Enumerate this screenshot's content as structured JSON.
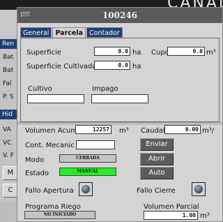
{
  "background": {
    "top_text": "CANAL",
    "side_headers": [
      "Ren",
      "Hid"
    ],
    "side_items_1": [
      "Bat",
      "Bat",
      "Fal",
      "P. S"
    ],
    "side_items_2": [
      "VA",
      "VC",
      "V. F"
    ],
    "side_buttons": [
      "M",
      "C"
    ]
  },
  "dialog": {
    "title": "100246",
    "tabs": [
      {
        "label": "General",
        "active": false
      },
      {
        "label": "Parcela",
        "active": true
      },
      {
        "label": "Contador",
        "active": false
      }
    ],
    "parcela": {
      "superficie_label": "Superficie",
      "superficie_value": "0.0",
      "superficie_unit": "ha",
      "cupo_label": "Cupo",
      "cupo_value": "0.0",
      "cupo_unit": "m³",
      "sup_cultivada_label": "Superficie Cultivada",
      "sup_cultivada_value": "0.0",
      "sup_cultivada_unit": "ha",
      "cultivo_label": "Cultivo",
      "cultivo_value": "",
      "impago_label": "Impago",
      "impago_value": ""
    },
    "contador": {
      "volumen_acum_label": "Volumen Acum",
      "volumen_acum_value": "12257",
      "volumen_acum_unit": "m³",
      "caudal_label": "Caudal",
      "caudal_value": "0.00",
      "caudal_unit": "m³/",
      "cont_mecanico_label": "Cont. Mecanico",
      "cont_mecanico_value": "",
      "modo_label": "Modo",
      "modo_value": "CERRADA",
      "estado_label": "Estado",
      "estado_value": "MANUAL",
      "estado_color": "#22ee22",
      "enviar_label": "Enviar",
      "abrir_label": "Abrir",
      "auto_label": "Auto",
      "fallo_apertura_label": "Fallo Apertura",
      "fallo_cierre_label": "Fallo Cierre",
      "programa_riego_label": "Programa Riego",
      "programa_riego_value": "NO INICIADO",
      "volumen_parcial_label": "Volumen Parcial",
      "volumen_parcial_value": "1.00",
      "volumen_parcial_unit": "m³"
    }
  }
}
